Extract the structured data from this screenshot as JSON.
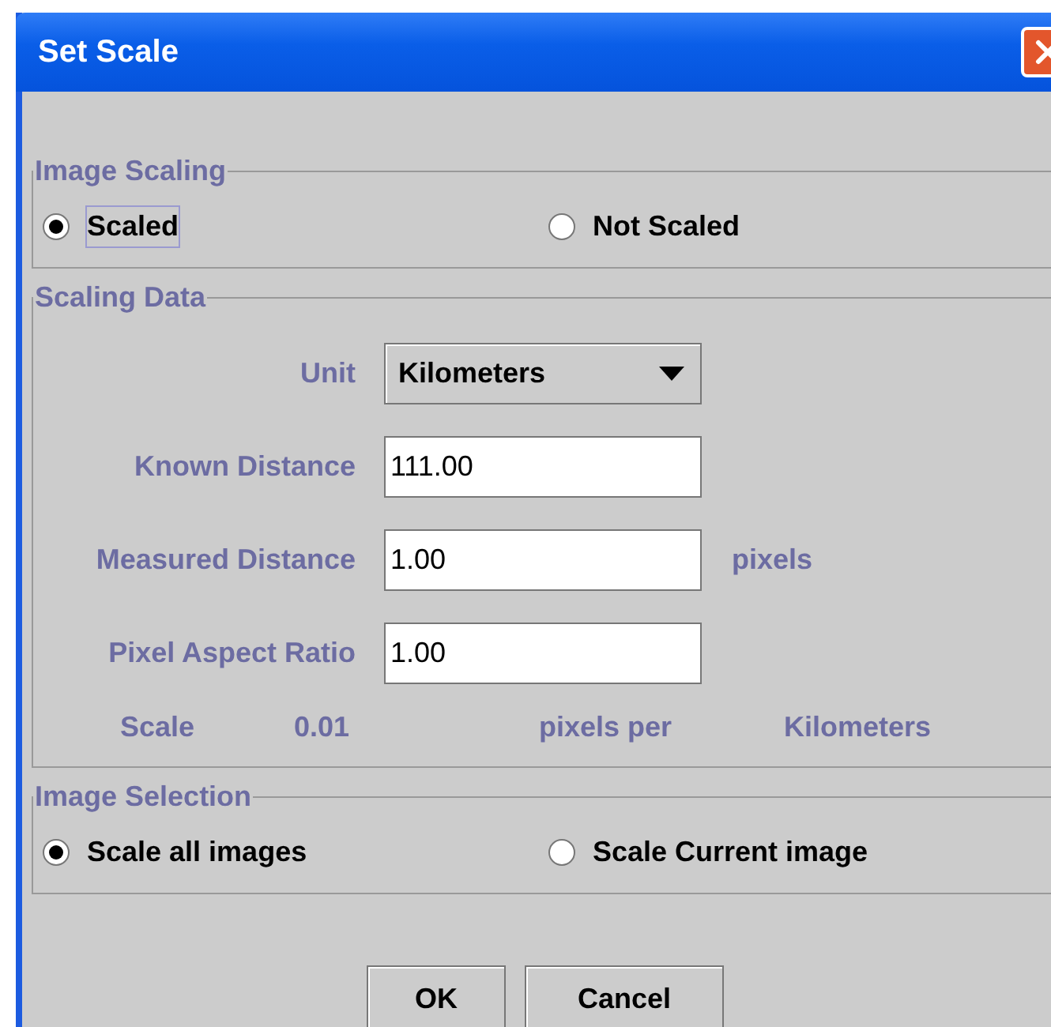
{
  "window": {
    "title": "Set Scale"
  },
  "groups": [
    {
      "title": "Image Scaling",
      "kind": "radios",
      "options": [
        {
          "label": "Scaled",
          "selected": true,
          "focused": true
        },
        {
          "label": "Not Scaled",
          "selected": false,
          "focused": false
        }
      ]
    },
    {
      "title": "Scaling Data",
      "kind": "form",
      "fields": [
        {
          "label": "Unit",
          "kind": "dropdown",
          "value": "Kilometers"
        },
        {
          "label": "Known Distance",
          "kind": "text",
          "value": "111.00"
        },
        {
          "label": "Measured Distance",
          "kind": "text",
          "value": "1.00",
          "suffix": "pixels"
        },
        {
          "label": "Pixel Aspect Ratio",
          "kind": "text",
          "value": "1.00"
        }
      ],
      "scale": {
        "label": "Scale",
        "value": "0.01",
        "per": "pixels per",
        "unit": "Kilometers"
      }
    },
    {
      "title": "Image Selection",
      "kind": "radios",
      "options": [
        {
          "label": "Scale all images",
          "selected": true,
          "focused": false
        },
        {
          "label": "Scale Current image",
          "selected": false,
          "focused": false
        }
      ]
    }
  ],
  "buttons": [
    "OK",
    "Cancel"
  ]
}
